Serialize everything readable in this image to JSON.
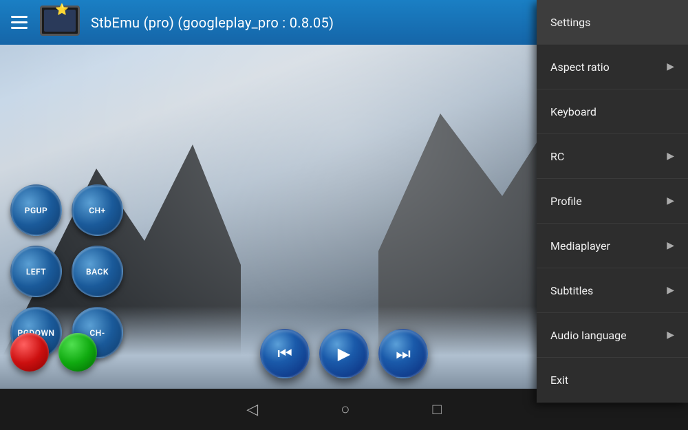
{
  "header": {
    "title": "StbEmu (pro) (googleplay_pro : 0.8.05)",
    "star": "⭐"
  },
  "controls": {
    "pgup_label": "PGUP",
    "ch_plus_label": "CH+",
    "left_label": "LEFT",
    "back_label": "BACK",
    "pgdown_label": "PGDOWN",
    "ch_minus_label": "CH-"
  },
  "playback": {
    "rewind_icon": "⏪",
    "play_icon": "▶",
    "forward_icon": "⏩"
  },
  "menu": {
    "items": [
      {
        "id": "settings",
        "label": "Settings",
        "has_arrow": false
      },
      {
        "id": "aspect-ratio",
        "label": "Aspect ratio",
        "has_arrow": true
      },
      {
        "id": "keyboard",
        "label": "Keyboard",
        "has_arrow": false
      },
      {
        "id": "rc",
        "label": "RC",
        "has_arrow": true
      },
      {
        "id": "profile",
        "label": "Profile",
        "has_arrow": true
      },
      {
        "id": "mediaplayer",
        "label": "Mediaplayer",
        "has_arrow": true
      },
      {
        "id": "subtitles",
        "label": "Subtitles",
        "has_arrow": true
      },
      {
        "id": "audio-language",
        "label": "Audio language",
        "has_arrow": true
      },
      {
        "id": "exit",
        "label": "Exit",
        "has_arrow": false
      }
    ]
  },
  "navbar": {
    "back_icon": "◁",
    "home_icon": "○",
    "recents_icon": "□"
  },
  "colors": {
    "header_bg": "#1a7fc4",
    "menu_bg": "#2d2d2d",
    "btn_blue": "#1a5a9a"
  }
}
